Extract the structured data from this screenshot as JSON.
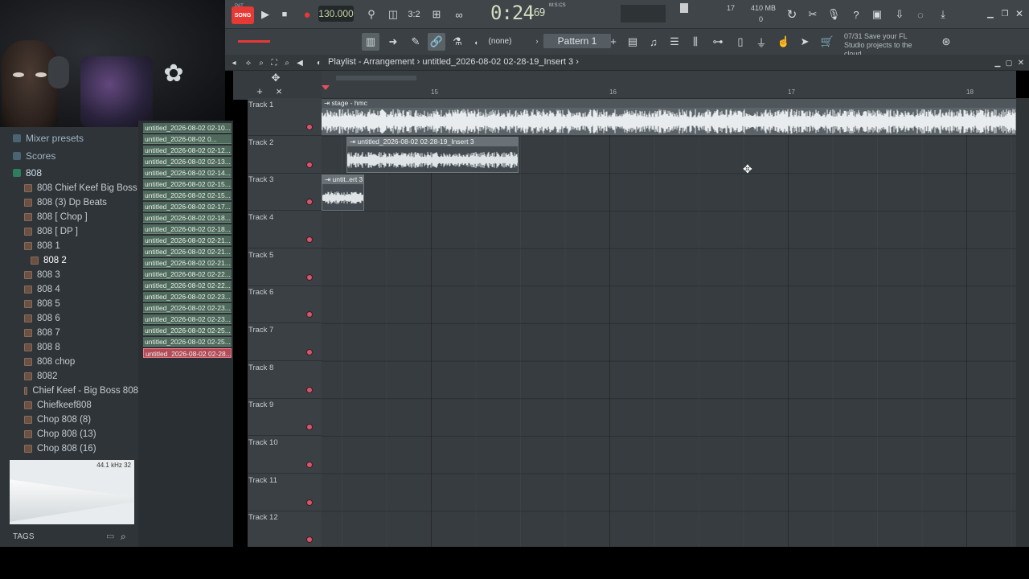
{
  "toolbar": {
    "mode_top": "PAT",
    "mode_label": "SONG",
    "tempo": "130.000",
    "time_main": "0:24",
    "time_ms": "69",
    "time_unit": "M:S:CS",
    "numerator": "3:2",
    "cpu_num": "17",
    "memory": "410 MB",
    "memory_sub": "0",
    "pattern_none": "(none)",
    "pattern": "Pattern 1",
    "hint_count": "07/31",
    "hint": "Save your FL Studio projects to the cloud",
    "accent_color": "#e53935"
  },
  "playlist": {
    "breadcrumb": [
      "Playlist - Arrangement",
      "untitled_2026-08-02 02-28-19_Insert 3"
    ],
    "ruler": [
      "15",
      "16",
      "17",
      "18"
    ],
    "tracks": [
      "Track 1",
      "Track 2",
      "Track 3",
      "Track 4",
      "Track 5",
      "Track 6",
      "Track 7",
      "Track 8",
      "Track 9",
      "Track 10",
      "Track 11",
      "Track 12"
    ],
    "clips": {
      "clip1": "stage - hmc",
      "clip2": "untitled_2026-08-02 02-28-19_Insert 3",
      "clip3": "untit..ert 3"
    }
  },
  "browser": {
    "categories": [
      "Mixer presets",
      "Scores",
      "808"
    ],
    "items": [
      "808  Chief Keef Big Boss",
      "808 (3) Dp Beats",
      "808 [ Chop ]",
      "808 [ DP ]",
      "808 1",
      "808 2",
      "808 3",
      "808 4",
      "808 5",
      "808 6",
      "808 7",
      "808 8",
      "808 chop",
      "8082",
      "Chief Keef - Big Boss 808",
      "Chiefkeef808",
      "Chop 808 (8)",
      "Chop 808 (13)",
      "Chop 808 (16)"
    ],
    "preview_info": "44.1 kHz 32",
    "tags_label": "TAGS"
  },
  "patterns": [
    "untitled_2026-08-02 02-10...",
    "untitled_2026-08-02 0...",
    "untitled_2026-08-02 02-12...",
    "untitled_2026-08-02 02-13...",
    "untitled_2026-08-02 02-14...",
    "untitled_2026-08-02 02-15...",
    "untitled_2026-08-02 02-15...",
    "untitled_2026-08-02 02-17...",
    "untitled_2026-08-02 02-18...",
    "untitled_2026-08-02 02-18...",
    "untitled_2026-08-02 02-21...",
    "untitled_2026-08-02 02-21...",
    "untitled_2026-08-02 02-21...",
    "untitled_2026-08-02 02-22...",
    "untitled_2026-08-02 02-22...",
    "untitled_2026-08-02 02-23...",
    "untitled_2026-08-02 02-23...",
    "untitled_2026-08-02 02-23...",
    "untitled_2026-08-02 02-25...",
    "untitled_2026-08-02 02-25...",
    "untitled_2026-08-02 02-28..."
  ]
}
